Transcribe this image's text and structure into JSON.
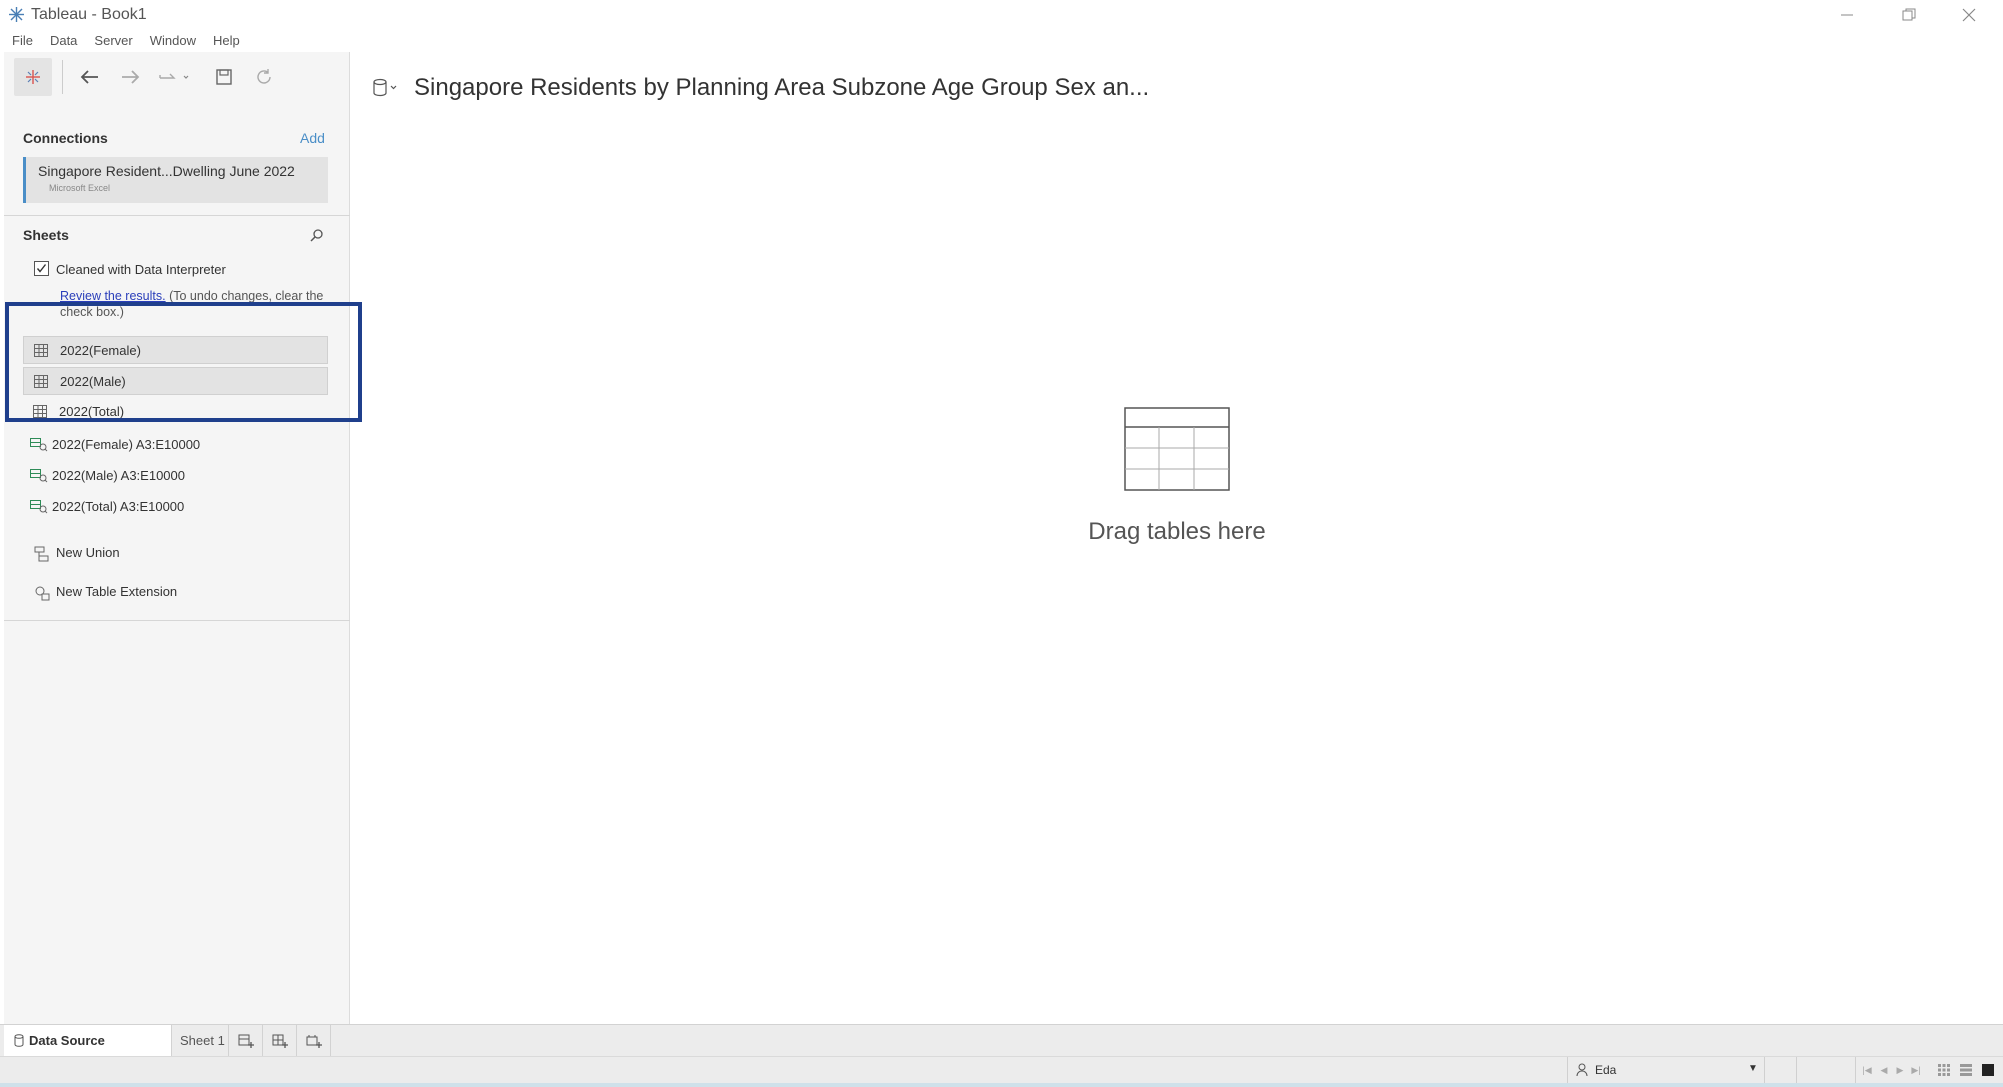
{
  "window": {
    "title": "Tableau - Book1"
  },
  "menu": {
    "items": [
      "File",
      "Data",
      "Server",
      "Window",
      "Help"
    ]
  },
  "connections": {
    "heading": "Connections",
    "add_label": "Add",
    "connection_name": "Singapore Resident...Dwelling June 2022",
    "connection_type": "Microsoft Excel"
  },
  "sheets": {
    "heading": "Sheets",
    "interpreter_label": "Cleaned with Data Interpreter",
    "interpreter_checked": true,
    "review_link": "Review the results.",
    "review_note": " (To undo changes, clear the check box.)",
    "tables": [
      {
        "label": "2022(Female)"
      },
      {
        "label": "2022(Male)"
      },
      {
        "label": "2022(Total)"
      }
    ],
    "ranges": [
      {
        "label": "2022(Female) A3:E10000"
      },
      {
        "label": "2022(Male) A3:E10000"
      },
      {
        "label": "2022(Total) A3:E10000"
      }
    ],
    "new_union_label": "New Union",
    "new_extension_label": "New Table Extension"
  },
  "canvas": {
    "datasource_title": "Singapore Residents by Planning Area Subzone Age Group Sex an...",
    "drop_hint": "Drag tables here"
  },
  "tabs": {
    "data_source_label": "Data Source",
    "sheet_label": "Sheet 1"
  },
  "status": {
    "user_name": "Eda"
  },
  "colors": {
    "accent_blue": "#4a8ec7",
    "highlight_navy": "#1f3f8c",
    "link_blue": "#2a3eba"
  }
}
